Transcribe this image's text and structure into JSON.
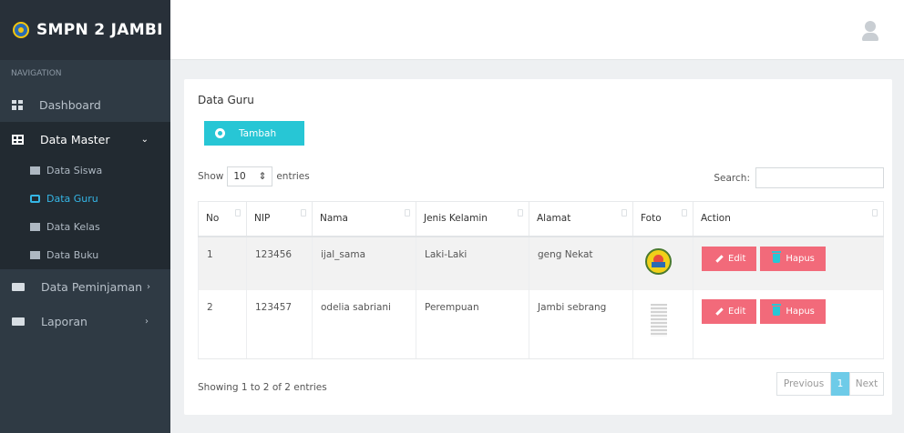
{
  "app": {
    "title": "SMPN 2 JAMBI"
  },
  "sidebar": {
    "header": "NAVIGATION",
    "items": [
      {
        "label": "Dashboard",
        "icon": "dashboard-icon"
      },
      {
        "label": "Data Master",
        "icon": "table-icon",
        "expanded": true
      },
      {
        "label": "Data Peminjaman",
        "icon": "card-icon"
      },
      {
        "label": "Laporan",
        "icon": "card-icon"
      }
    ],
    "submenu": [
      {
        "label": "Data Siswa",
        "icon": "users-icon"
      },
      {
        "label": "Data Guru",
        "icon": "teacher-icon",
        "active": true
      },
      {
        "label": "Data Kelas",
        "icon": "grid-icon"
      },
      {
        "label": "Data Buku",
        "icon": "book-icon"
      }
    ]
  },
  "panel": {
    "title": "Data Guru",
    "add_label": "Tambah",
    "show_label": "Show",
    "entries_value": "10",
    "entries_label": "entries",
    "search_label": "Search:",
    "search_value": "",
    "columns": [
      "No",
      "NIP",
      "Nama",
      "Jenis Kelamin",
      "Alamat",
      "Foto",
      "Action"
    ],
    "rows": [
      {
        "no": "1",
        "nip": "123456",
        "nama": "ijal_sama",
        "jk": "Laki-Laki",
        "alamat": "geng Nekat",
        "foto": "school-logo-image"
      },
      {
        "no": "2",
        "nip": "123457",
        "nama": "odelia sabriani",
        "jk": "Perempuan",
        "alamat": "Jambi sebrang",
        "foto": "document-image"
      }
    ],
    "edit_label": "Edit",
    "delete_label": "Hapus",
    "info": "Showing 1 to 2 of 2 entries",
    "pager": {
      "prev": "Previous",
      "current": "1",
      "next": "Next"
    }
  },
  "colors": {
    "sidebar": "#2f3a44",
    "accent": "#27c6d5",
    "danger": "#f26a7a",
    "active_link": "#35b6e6"
  }
}
